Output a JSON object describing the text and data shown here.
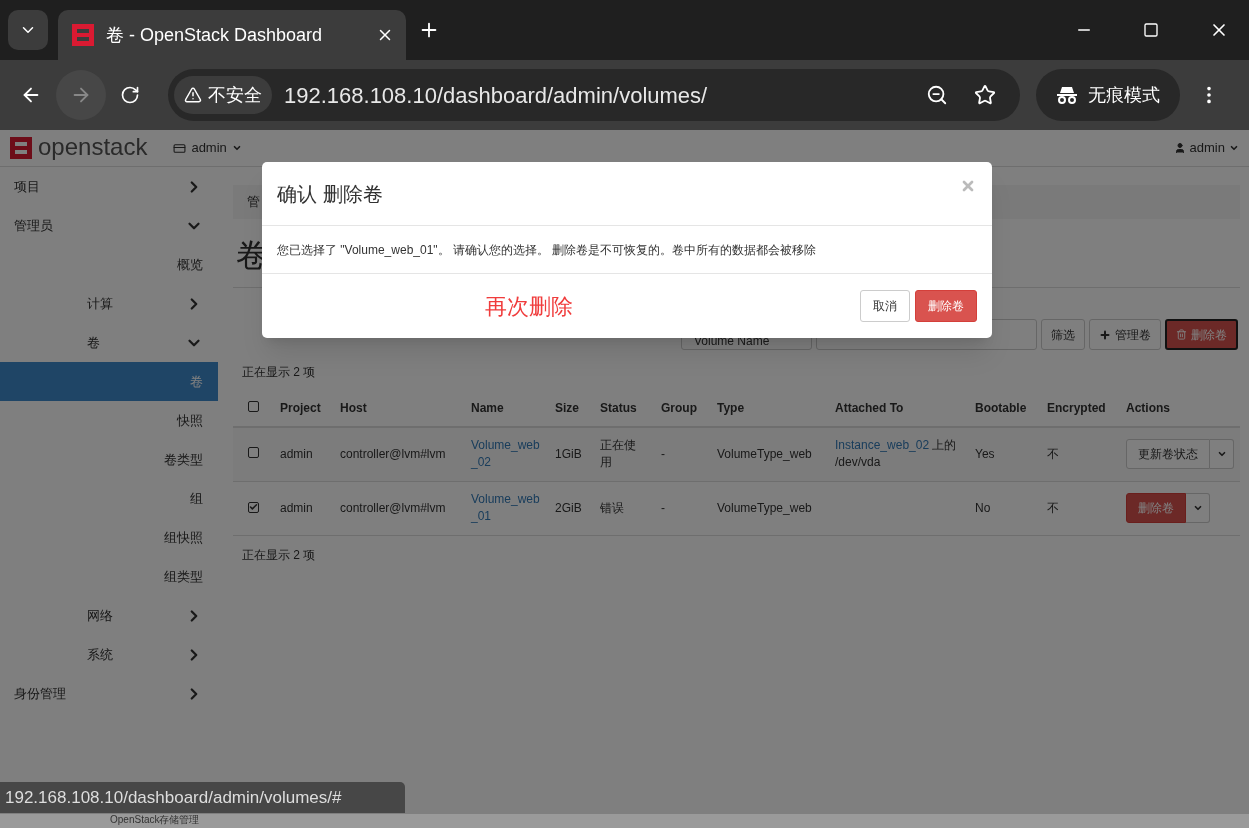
{
  "browser": {
    "tab_title": "卷 - OpenStack Dashboard",
    "security_label": "不安全",
    "url": "192.168.108.10/dashboard/admin/volumes/",
    "incognito_label": "无痕模式"
  },
  "header": {
    "logo_text": "openstack",
    "project_menu": "admin",
    "user_menu": "admin"
  },
  "sidebar": [
    {
      "label": "项目",
      "expanded": false
    },
    {
      "label": "管理员",
      "expanded": true,
      "children": [
        {
          "label": "概览",
          "selected": false
        },
        {
          "label": "计算",
          "expanded": false
        },
        {
          "label": "卷",
          "expanded": true,
          "children": [
            {
              "label": "卷",
              "selected": true
            },
            {
              "label": "快照",
              "selected": false
            },
            {
              "label": "卷类型",
              "selected": false
            },
            {
              "label": "组",
              "selected": false
            },
            {
              "label": "组快照",
              "selected": false
            },
            {
              "label": "组类型",
              "selected": false
            }
          ]
        },
        {
          "label": "网络",
          "expanded": false
        },
        {
          "label": "系统",
          "expanded": false
        }
      ]
    },
    {
      "label": "身份管理",
      "expanded": false
    }
  ],
  "breadcrumb": "管",
  "page_title": "卷",
  "filter_bar": {
    "select": "Volume Name",
    "buttons": [
      {
        "label": "筛选",
        "kind": "default"
      },
      {
        "label": "管理卷",
        "kind": "add"
      },
      {
        "label": "删除卷",
        "kind": "danger"
      }
    ]
  },
  "count_top": "正在显示 2 项",
  "table": {
    "header_checked": false,
    "columns": [
      "Project",
      "Host",
      "Name",
      "Size",
      "Status",
      "Group",
      "Type",
      "Attached To",
      "Bootable",
      "Encrypted",
      "Actions"
    ],
    "rows": [
      {
        "checked": false,
        "project": "admin",
        "host": "controller@lvm#lvm",
        "name": "Volume_web_02",
        "size": "1GiB",
        "status": "正在使用",
        "group": "-",
        "type": "VolumeType_web",
        "attached_link": "Instance_web_02",
        "attached_text": "上的 /dev/vda",
        "bootable": "Yes",
        "encrypted": "不",
        "action": {
          "label": "更新卷状态",
          "kind": "default"
        }
      },
      {
        "checked": true,
        "project": "admin",
        "host": "controller@lvm#lvm",
        "name": "Volume_web_01",
        "size": "2GiB",
        "status": "错误",
        "group": "-",
        "type": "VolumeType_web",
        "bootable": "No",
        "encrypted": "不",
        "action": {
          "label": "删除卷",
          "kind": "danger"
        }
      }
    ]
  },
  "count_bottom": "正在显示 2 项",
  "modal": {
    "title": "确认 删除卷",
    "message": "您已选择了 \"Volume_web_01\"。 请确认您的选择。 删除卷是不可恢复的。卷中所有的数据都会被移除",
    "annotation": "再次删除",
    "cancel": "取消",
    "confirm": "删除卷"
  },
  "status_url": "192.168.108.10/dashboard/admin/volumes/#",
  "background_window_title": "OpenStack存储管理"
}
